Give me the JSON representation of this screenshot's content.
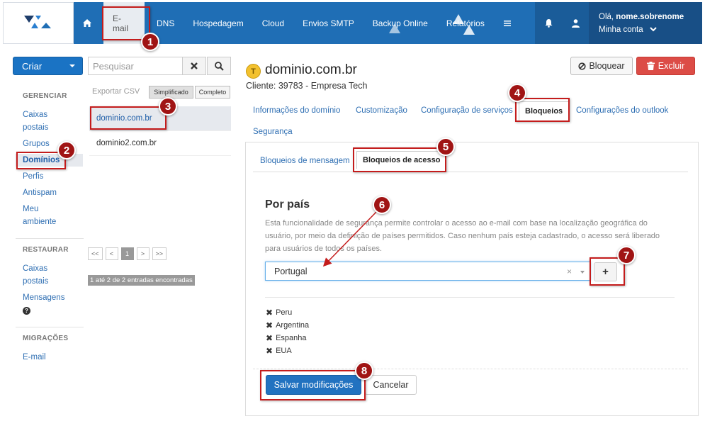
{
  "topnav": {
    "items": [
      "E-mail",
      "DNS",
      "Hospedagem",
      "Cloud",
      "Envios SMTP",
      "Backup Online",
      "Relatórios"
    ],
    "greeting_prefix": "Olá, ",
    "username": "nome.sobrenome",
    "account": "Minha conta"
  },
  "left": {
    "create_label": "Criar",
    "gerenciar_title": "GERENCIAR",
    "gerenciar": [
      "Caixas postais",
      "Grupos",
      "Domínios",
      "Perfis",
      "Antispam",
      "Meu ambiente"
    ],
    "restaurar_title": "RESTAURAR",
    "restaurar": [
      "Caixas postais",
      "Mensagens"
    ],
    "migracoes_title": "MIGRAÇÕES",
    "migracoes": [
      "E-mail"
    ]
  },
  "list": {
    "search_placeholder": "Pesquisar",
    "export_csv": "Exportar CSV",
    "view_simplified": "Simplificado",
    "view_complete": "Completo",
    "domains": [
      "dominio.com.br",
      "dominio2.com.br"
    ],
    "pager": [
      "<<",
      "<",
      "1",
      ">",
      ">>"
    ],
    "entries": "1 até 2 de 2 entradas encontradas"
  },
  "detail": {
    "coin_letter": "T",
    "domain": "dominio.com.br",
    "client": "Cliente: 39783 - Empresa Tech",
    "block_label": "Bloquear",
    "delete_label": "Excluir",
    "tabs": [
      "Informações do domínio",
      "Customização",
      "Configuração de serviços",
      "Bloqueios",
      "Configurações do outlook",
      "Segurança"
    ],
    "subtabs": [
      "Bloqueios de mensagem",
      "Bloqueios de acesso"
    ],
    "section_title": "Por país",
    "description": "Esta funcionalidade de segurança permite controlar o acesso ao e-mail com base na localização geográfica do usuário, por meio da definição de países permitidos. Caso nenhum país esteja cadastrado, o acesso será liberado para usuários de todos os países.",
    "selected_country": "Portugal",
    "add_symbol": "+",
    "countries": [
      "Peru",
      "Argentina",
      "Espanha",
      "EUA"
    ],
    "save_label": "Salvar modificações",
    "cancel_label": "Cancelar"
  },
  "annotations": [
    "1",
    "2",
    "3",
    "4",
    "5",
    "6",
    "7",
    "8"
  ],
  "colors": {
    "topbar": "#1f6eb5",
    "accent": "#2272c0",
    "danger": "#dc4c46",
    "annotation": "#a01414"
  }
}
